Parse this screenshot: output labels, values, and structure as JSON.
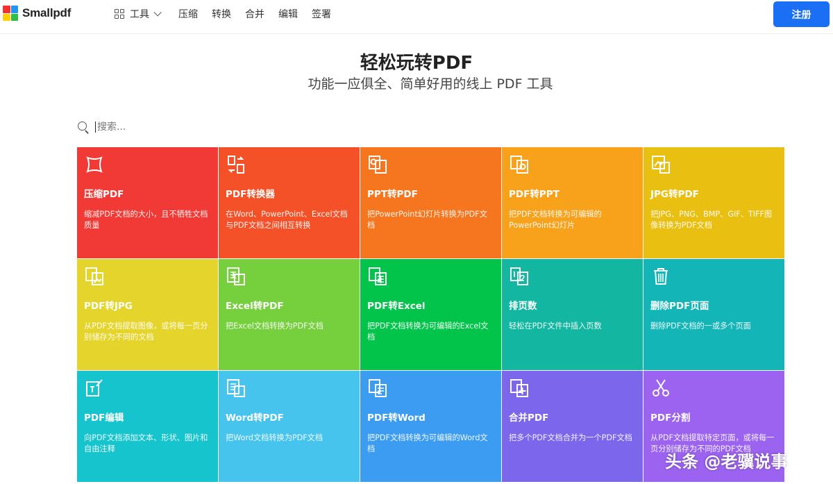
{
  "brand": {
    "name": "Smallpdf",
    "logo_colors": [
      "#f4312e",
      "#2196f3",
      "#ffd000",
      "#2fbe4a"
    ]
  },
  "nav": {
    "tools_label": "工具",
    "links": [
      "压缩",
      "转换",
      "合并",
      "编辑",
      "签署"
    ],
    "signup_label": "注册",
    "signup_color": "#1a6ff5"
  },
  "hero": {
    "title": "轻松玩转PDF",
    "subtitle": "功能一应俱全、简单好用的线上 PDF 工具"
  },
  "search": {
    "placeholder": "搜索..."
  },
  "tools": [
    {
      "title": "压缩PDF",
      "desc": "缩减PDF文档的大小，且不牺牲文档质量",
      "color": "#f13a35",
      "icon": "compress-icon"
    },
    {
      "title": "PDF转换器",
      "desc": "在Word、PowerPoint、Excel文档与PDF文档之间相互转换",
      "color": "#f45128",
      "icon": "convert-icon"
    },
    {
      "title": "PPT转PDF",
      "desc": "把PowerPoint幻灯片转换为PDF文档",
      "color": "#f6761f",
      "icon": "ppt-to-pdf-icon"
    },
    {
      "title": "PDF转PPT",
      "desc": "把PDF文档转换为可编辑的PowerPoint幻灯片",
      "color": "#f8a11b",
      "icon": "pdf-to-ppt-icon"
    },
    {
      "title": "JPG转PDF",
      "desc": "把JPG、PNG、BMP、GIF、TIFF图像转换为PDF文档",
      "color": "#e9bf11",
      "icon": "jpg-to-pdf-icon"
    },
    {
      "title": "PDF转JPG",
      "desc": "从PDF文档提取图像，或将每一页分别储存为不同的文档",
      "color": "#e4d42b",
      "icon": "pdf-to-jpg-icon"
    },
    {
      "title": "Excel转PDF",
      "desc": "把Excel文档转换为PDF文档",
      "color": "#76cf3c",
      "icon": "excel-to-pdf-icon"
    },
    {
      "title": "PDF转Excel",
      "desc": "把PDF文档转换为可编辑的Excel文档",
      "color": "#03c44a",
      "icon": "pdf-to-excel-icon"
    },
    {
      "title": "排页数",
      "desc": "轻松在PDF文件中插入页数",
      "color": "#13b6a1",
      "icon": "page-number-icon"
    },
    {
      "title": "删除PDF页面",
      "desc": "删除PDF文档的一或多个页面",
      "color": "#14b5b7",
      "icon": "trash-icon"
    },
    {
      "title": "PDF编辑",
      "desc": "向PDF文档添加文本、形状、图片和自由注释",
      "color": "#15c4cc",
      "icon": "edit-icon"
    },
    {
      "title": "Word转PDF",
      "desc": "把Word文档转换为PDF文档",
      "color": "#46c4ee",
      "icon": "word-to-pdf-icon"
    },
    {
      "title": "PDF转Word",
      "desc": "把PDF文档转换为可编辑的Word文档",
      "color": "#3b9cf1",
      "icon": "pdf-to-word-icon"
    },
    {
      "title": "合并PDF",
      "desc": "把多个PDF文档合并为一个PDF文档",
      "color": "#7c66ec",
      "icon": "merge-icon"
    },
    {
      "title": "PDF分割",
      "desc": "从PDF文档提取特定页面，或将每一页分别储存为不同的PDF文档",
      "color": "#9b63f0",
      "icon": "scissors-icon"
    }
  ],
  "watermark": "头条 @老骥说事"
}
